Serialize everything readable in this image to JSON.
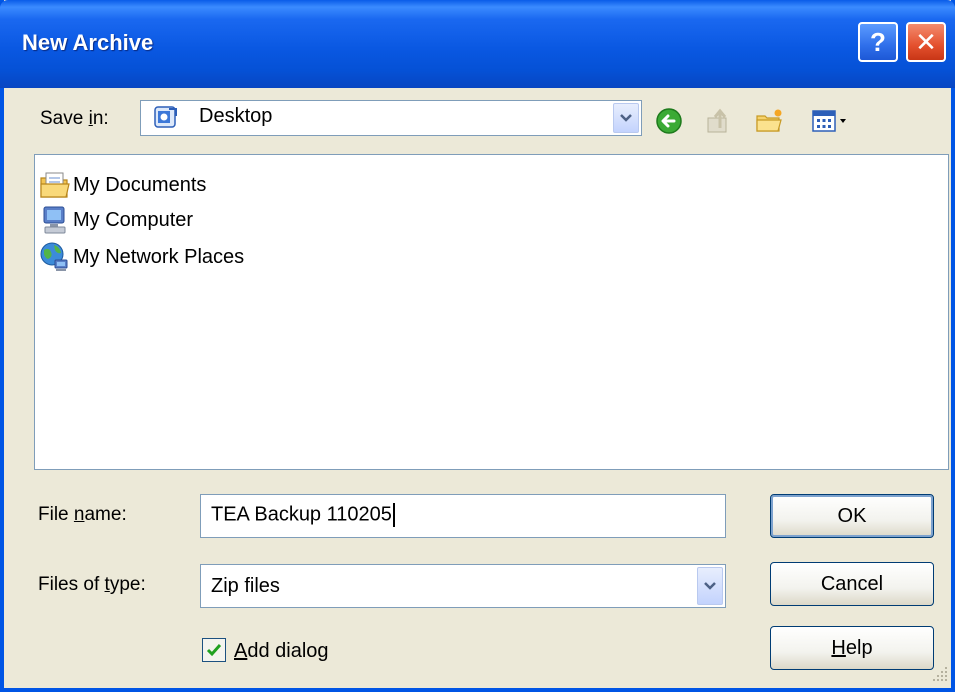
{
  "window": {
    "title": "New Archive",
    "help_button": "?",
    "close_button": "✕"
  },
  "save_in": {
    "label_pre": "Save ",
    "label_accel": "i",
    "label_post": "n:",
    "value": "Desktop"
  },
  "toolbar": {
    "icons": [
      "back-icon",
      "up-folder-icon",
      "new-folder-icon",
      "view-menu-icon"
    ]
  },
  "files": [
    {
      "label": "My Documents",
      "icon": "my-documents-icon"
    },
    {
      "label": "My Computer",
      "icon": "my-computer-icon"
    },
    {
      "label": "My Network Places",
      "icon": "my-network-places-icon"
    }
  ],
  "file_name": {
    "label_pre": "File ",
    "label_accel": "n",
    "label_post": "ame:",
    "value": "TEA Backup 110205"
  },
  "file_type": {
    "label_pre": "Files of ",
    "label_accel": "t",
    "label_post": "ype:",
    "value": "Zip files"
  },
  "add_dialog": {
    "label_accel": "A",
    "label_post": "dd dialog",
    "checked": true
  },
  "buttons": {
    "ok": "OK",
    "cancel": "Cancel",
    "help_accel": "H",
    "help_post": "elp"
  }
}
